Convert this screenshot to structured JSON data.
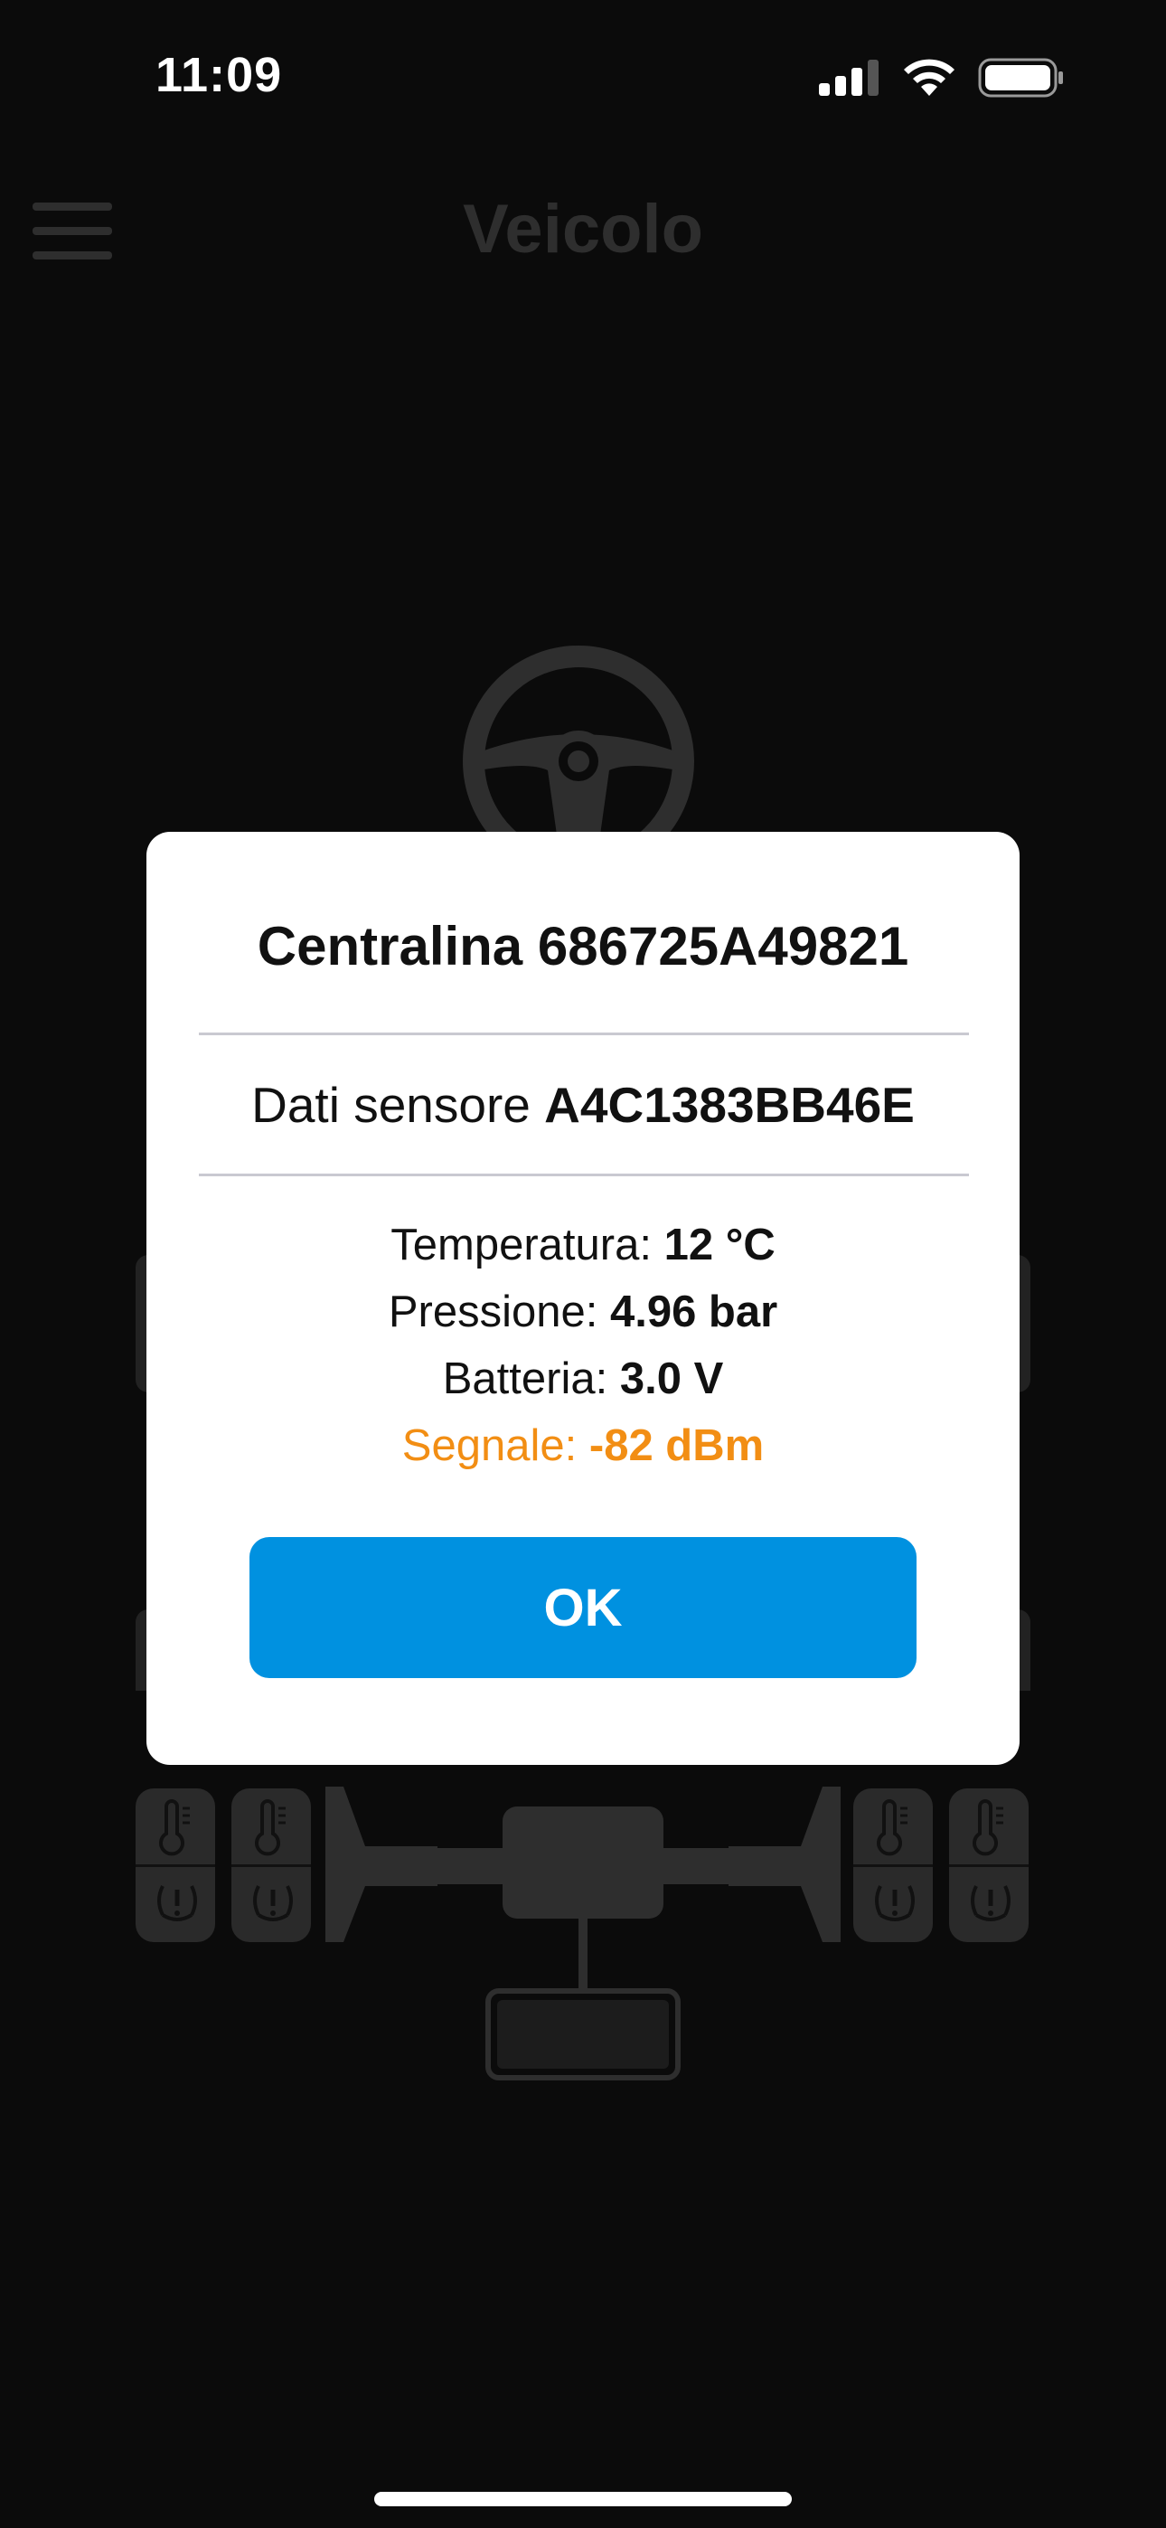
{
  "status_bar": {
    "time": "11:09"
  },
  "header": {
    "title": "Veicolo",
    "menu_icon": "hamburger-menu-icon"
  },
  "dialog": {
    "title": "Centralina 686725A49821",
    "subtitle_label": "Dati sensore",
    "subtitle_value": "A4C1383BB46E",
    "readings": {
      "temperature_label": "Temperatura:",
      "temperature_value": "12 °C",
      "pressure_label": "Pressione:",
      "pressure_value": "4.96 bar",
      "battery_label": "Batteria:",
      "battery_value": "3.0 V",
      "signal_label": "Segnale:",
      "signal_value": "-82 dBm"
    },
    "ok_label": "OK"
  },
  "colors": {
    "accent": "#0091e0",
    "signal_warning": "#f28e14",
    "background": "#0b0b0b",
    "dim_icon": "#2e2e2e"
  }
}
